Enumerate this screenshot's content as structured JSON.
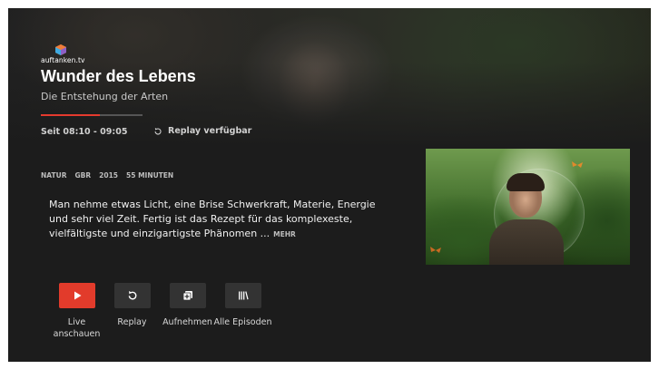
{
  "brand": {
    "logo_text": "auftanken.tv"
  },
  "program": {
    "title": "Wunder des Lebens",
    "subtitle": "Die Entstehung der Arten",
    "progress_fraction": 0.58,
    "time_text": "Seit 08:10 - 09:05",
    "replay_text": "Replay verfügbar",
    "meta": [
      "NATUR",
      "GBR",
      "2015",
      "55 MINUTEN"
    ],
    "description": "Man nehme etwas Licht, eine Brise Schwerkraft, Materie, Energie und sehr viel Zeit. Fertig ist das Rezept für das komplexeste, vielfältigste und einzigartigste Phänomen ...",
    "more_label": "MEHR"
  },
  "actions": [
    {
      "label": "Live anschauen",
      "icon": "play-icon"
    },
    {
      "label": "Replay",
      "icon": "replay-icon"
    },
    {
      "label": "Aufnehmen",
      "icon": "record-add-icon"
    },
    {
      "label": "Alle Episoden",
      "icon": "library-icon"
    }
  ],
  "colors": {
    "accent": "#e23b2b",
    "background": "#1c1c1c",
    "button": "#333333"
  }
}
